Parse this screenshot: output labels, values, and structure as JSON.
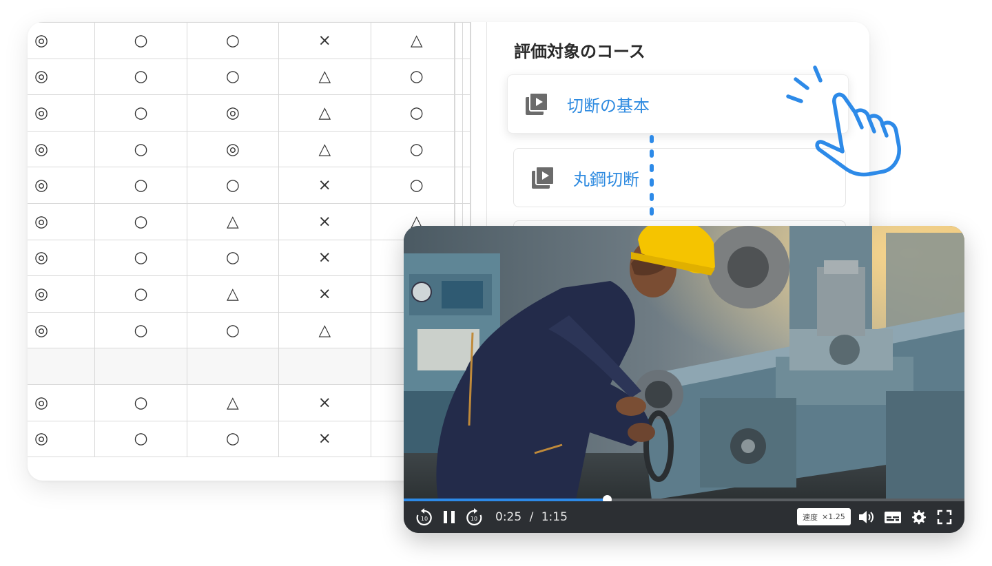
{
  "matrix": {
    "rows": [
      [
        "◎",
        "○",
        "○",
        "×",
        "△"
      ],
      [
        "◎",
        "○",
        "○",
        "△",
        "○"
      ],
      [
        "◎",
        "○",
        "◎",
        "△",
        "○"
      ],
      [
        "◎",
        "○",
        "◎",
        "△",
        "○"
      ],
      [
        "◎",
        "○",
        "○",
        "×",
        "○"
      ],
      [
        "◎",
        "○",
        "△",
        "×",
        "△"
      ],
      [
        "◎",
        "○",
        "○",
        "×",
        ""
      ],
      [
        "◎",
        "○",
        "△",
        "×",
        ""
      ],
      [
        "◎",
        "○",
        "○",
        "△",
        ""
      ],
      [
        "",
        "",
        "",
        "",
        ""
      ],
      [
        "◎",
        "○",
        "△",
        "×",
        ""
      ],
      [
        "◎",
        "○",
        "○",
        "×",
        ""
      ]
    ]
  },
  "course_panel": {
    "heading": "評価対象のコース",
    "courses": [
      {
        "label": "切断の基本",
        "icon": "video-library-icon",
        "active": true
      },
      {
        "label": "丸鋼切断",
        "icon": "video-library-icon",
        "active": false
      }
    ]
  },
  "player": {
    "current_time": "0:25",
    "separator": "/",
    "duration": "1:15",
    "progress": 0.363,
    "speed_label": "速度",
    "speed_value": "×1.25",
    "rewind_seconds": "10",
    "forward_seconds": "10",
    "controls": [
      "rewind-10-icon",
      "pause-icon",
      "forward-10-icon",
      "volume-icon",
      "subtitles-icon",
      "settings-gear-icon",
      "fullscreen-icon"
    ]
  },
  "colors": {
    "accent": "#2d8ae8",
    "course_text": "#2f8be0",
    "hard_hat": "#f5c400",
    "controls_bg": "#2c2f33"
  }
}
